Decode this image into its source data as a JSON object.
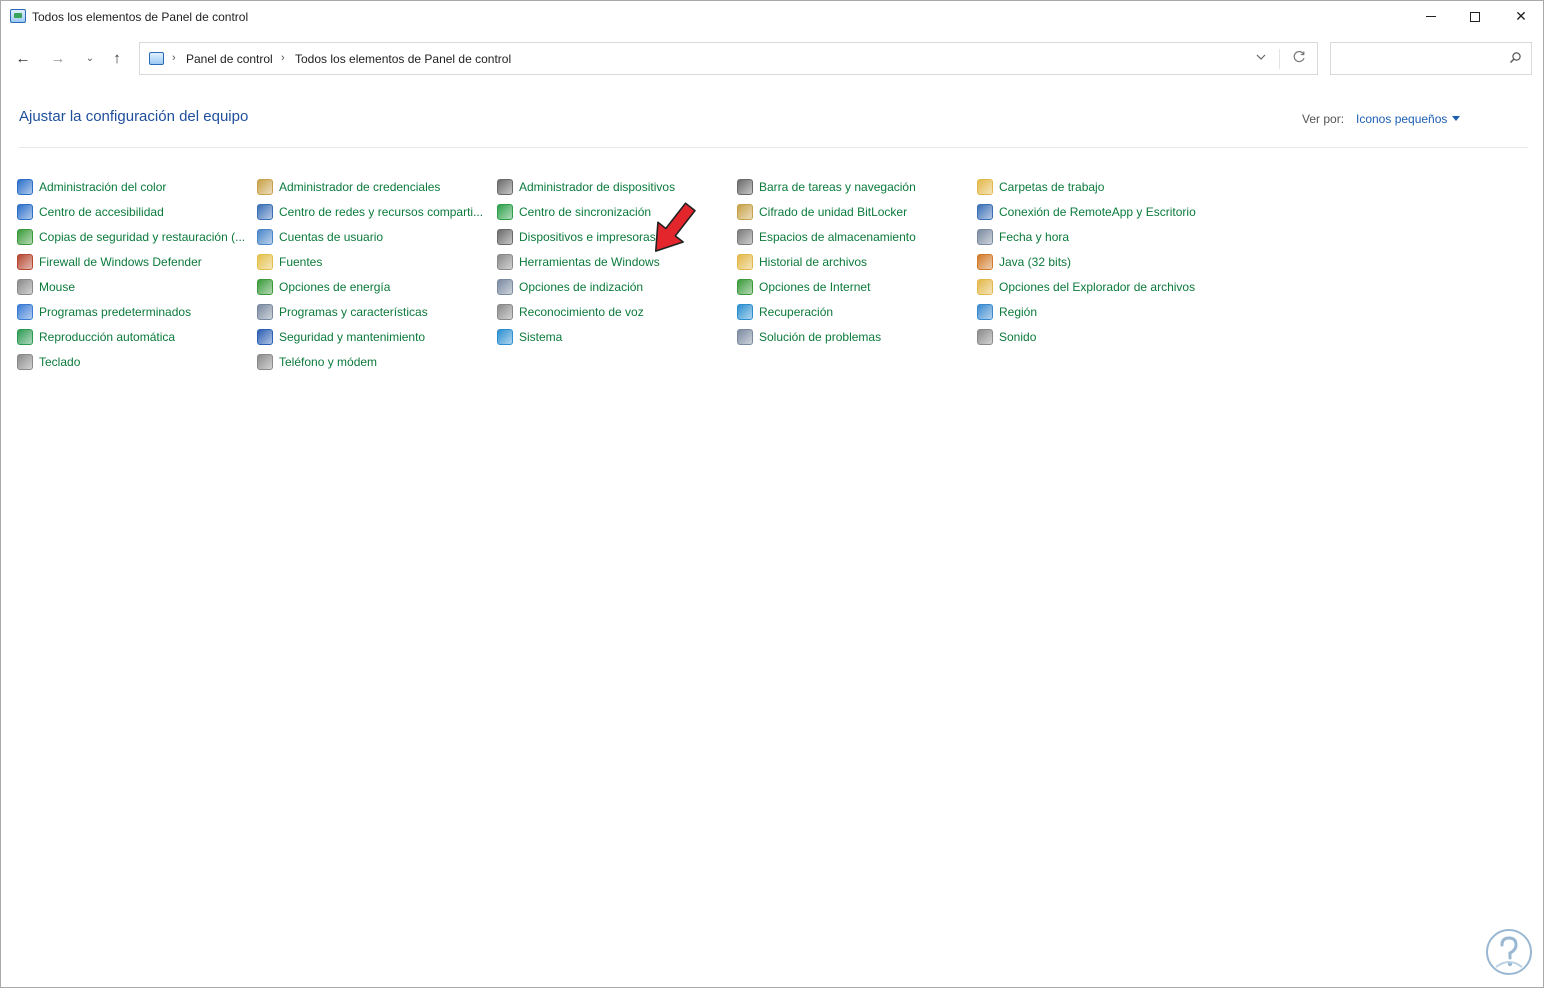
{
  "window": {
    "title": "Todos los elementos de Panel de control"
  },
  "address": {
    "crumbs": [
      "Panel de control",
      "Todos los elementos de Panel de control"
    ],
    "separator": "›"
  },
  "search": {
    "placeholder": ""
  },
  "header": {
    "title": "Ajustar la configuración del equipo",
    "view_by_label": "Ver por:",
    "view_by_value": "Iconos pequeños"
  },
  "items": [
    {
      "label": "Administración del color",
      "icon": "color-management-icon",
      "color": "#2b6fc9"
    },
    {
      "label": "Centro de accesibilidad",
      "icon": "accessibility-icon",
      "color": "#2b6fc9"
    },
    {
      "label": "Copias de seguridad y restauración (...",
      "icon": "backup-icon",
      "color": "#3a9a3a"
    },
    {
      "label": "Firewall de Windows Defender",
      "icon": "firewall-icon",
      "color": "#b5462f"
    },
    {
      "label": "Mouse",
      "icon": "mouse-icon",
      "color": "#8a8a8a"
    },
    {
      "label": "Programas predeterminados",
      "icon": "default-programs-icon",
      "color": "#3a7bd5"
    },
    {
      "label": "Reproducción automática",
      "icon": "autoplay-icon",
      "color": "#2d9a52"
    },
    {
      "label": "Teclado",
      "icon": "keyboard-icon",
      "color": "#8a8a8a"
    },
    {
      "label": "Administrador de credenciales",
      "icon": "credentials-icon",
      "color": "#c8a24a"
    },
    {
      "label": "Centro de redes y recursos comparti...",
      "icon": "network-icon",
      "color": "#3b6fb6"
    },
    {
      "label": "Cuentas de usuario",
      "icon": "user-accounts-icon",
      "color": "#4a86c8"
    },
    {
      "label": "Fuentes",
      "icon": "fonts-icon",
      "color": "#e3c04a"
    },
    {
      "label": "Opciones de energía",
      "icon": "power-icon",
      "color": "#3a9a3a"
    },
    {
      "label": "Programas y características",
      "icon": "programs-features-icon",
      "color": "#7a8aa0"
    },
    {
      "label": "Seguridad y mantenimiento",
      "icon": "security-flag-icon",
      "color": "#2b5fb4"
    },
    {
      "label": "Teléfono y módem",
      "icon": "phone-modem-icon",
      "color": "#8a8a8a"
    },
    {
      "label": "Administrador de dispositivos",
      "icon": "device-manager-icon",
      "color": "#6a6a6a"
    },
    {
      "label": "Centro de sincronización",
      "icon": "sync-icon",
      "color": "#2da04a"
    },
    {
      "label": "Dispositivos e impresoras",
      "icon": "printer-icon",
      "color": "#6a6a6a"
    },
    {
      "label": "Herramientas de Windows",
      "icon": "windows-tools-icon",
      "color": "#8a8a8a"
    },
    {
      "label": "Opciones de indización",
      "icon": "indexing-icon",
      "color": "#7a8aa0"
    },
    {
      "label": "Reconocimiento de voz",
      "icon": "microphone-icon",
      "color": "#8a8a8a"
    },
    {
      "label": "Sistema",
      "icon": "system-icon",
      "color": "#2b8fd0"
    },
    {
      "label": "Barra de tareas y navegación",
      "icon": "taskbar-icon",
      "color": "#6a6a6a"
    },
    {
      "label": "Cifrado de unidad BitLocker",
      "icon": "bitlocker-icon",
      "color": "#c8a24a"
    },
    {
      "label": "Espacios de almacenamiento",
      "icon": "storage-icon",
      "color": "#7a7a7a"
    },
    {
      "label": "Historial de archivos",
      "icon": "file-history-icon",
      "color": "#e3b84a"
    },
    {
      "label": "Opciones de Internet",
      "icon": "internet-icon",
      "color": "#3a9a3a"
    },
    {
      "label": "Recuperación",
      "icon": "recovery-icon",
      "color": "#2b8fd0"
    },
    {
      "label": "Solución de problemas",
      "icon": "troubleshoot-icon",
      "color": "#7a8aa0"
    },
    {
      "label": "Carpetas de trabajo",
      "icon": "work-folders-icon",
      "color": "#e3b84a"
    },
    {
      "label": "Conexión de RemoteApp y Escritorio",
      "icon": "remoteapp-icon",
      "color": "#3b6fb6"
    },
    {
      "label": "Fecha y hora",
      "icon": "date-time-icon",
      "color": "#7a8aa0"
    },
    {
      "label": "Java (32 bits)",
      "icon": "java-icon",
      "color": "#d07a2a"
    },
    {
      "label": "Opciones del Explorador de archivos",
      "icon": "folder-options-icon",
      "color": "#e3b84a"
    },
    {
      "label": "Región",
      "icon": "region-icon",
      "color": "#3a8ad0"
    },
    {
      "label": "Sonido",
      "icon": "sound-icon",
      "color": "#8a8a8a"
    }
  ],
  "colors": {
    "link_green": "#0b7a3b",
    "heading_blue": "#1e4f9c",
    "accent_blue": "#1e5fb4",
    "pointer_red": "#e3262c"
  }
}
